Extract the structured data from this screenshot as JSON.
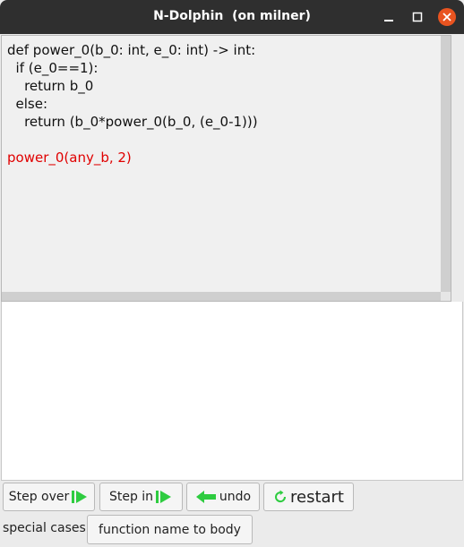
{
  "window": {
    "title": "N-Dolphin  (on milner)"
  },
  "code": {
    "lines": [
      {
        "text": "def power_0(b_0: int, e_0: int) -> int:",
        "color": "#111111"
      },
      {
        "text": "  if (e_0==1):",
        "color": "#111111"
      },
      {
        "text": "    return b_0",
        "color": "#111111"
      },
      {
        "text": "  else:",
        "color": "#111111"
      },
      {
        "text": "    return (b_0*power_0(b_0, (e_0-1)))",
        "color": "#111111"
      },
      {
        "text": "",
        "color": "#111111"
      },
      {
        "text": "power_0(any_b, 2)",
        "color": "#e00000"
      }
    ]
  },
  "toolbar": {
    "step_over_label": "Step over",
    "step_in_label": "Step in",
    "undo_label": "undo",
    "restart_label": "restart"
  },
  "special": {
    "label": "special cases:",
    "function_name_to_body_label": "function name to body"
  },
  "colors": {
    "accent_green": "#2ecc40",
    "close_orange": "#e95420",
    "highlight_red": "#e00000"
  },
  "icons": {
    "step_over": "play-bar-icon",
    "step_in": "play-bar-icon",
    "undo": "left-arrow-icon",
    "restart": "circular-arrow-icon"
  }
}
